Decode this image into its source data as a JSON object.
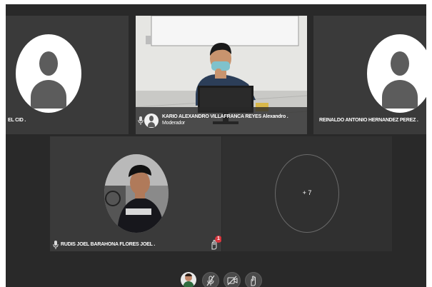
{
  "participants": {
    "left_partial": {
      "name": "EL CID ."
    },
    "moderator": {
      "name": "KARIO ALEXANDRO VILLAFRANCA REYES Alexandro .",
      "role": "Moderador"
    },
    "right": {
      "name": "REINALDO ANTONIO HERNANDEZ PEREZ ."
    },
    "rudis": {
      "name": "RUDIS JOEL BARAHONA FLORES JOEL .",
      "badge": "1"
    },
    "more": {
      "label": "+ 7"
    }
  },
  "icons": {
    "mic": "microphone-icon",
    "muted_mic": "microphone-muted-icon",
    "video_off": "video-off-icon",
    "hand": "raise-hand-icon"
  },
  "colors": {
    "background": "#292929",
    "tile": "#3a3a3a",
    "badge": "#d9363e",
    "avatar": "#5c5c5c"
  }
}
